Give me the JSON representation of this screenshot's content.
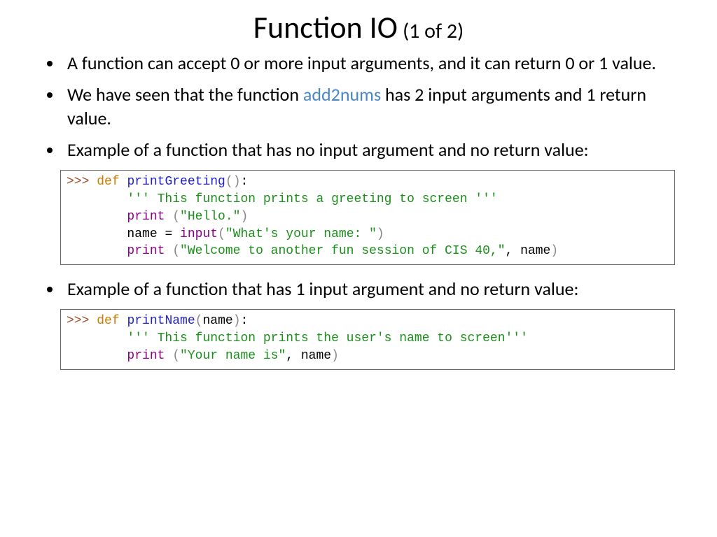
{
  "title": {
    "main": "Function IO",
    "sub": "(1 of 2)"
  },
  "bullets": [
    {
      "text_before": "A function can accept 0 or more input arguments, and it can return 0 or 1 value.",
      "link": "",
      "text_after": ""
    },
    {
      "text_before": "We have seen that the function ",
      "link": "add2nums",
      "text_after": " has 2 input arguments and 1 return value."
    },
    {
      "text_before": "Example of a function that has no input argument and no return value:",
      "link": "",
      "text_after": ""
    }
  ],
  "bullet4": "Example of a function that has 1 input argument and no return value:",
  "code1": {
    "prompt": ">>> ",
    "kw_def": "def",
    "fn": "printGreeting",
    "lp": "(",
    "rp": ")",
    "colon": ":",
    "doc": "''' This function prints a greeting to screen '''",
    "print": "print",
    "sp_open": " (",
    "tp": "(",
    "cp": ")",
    "str_hello": "\"Hello.\"",
    "var_name": "name",
    "assign": " = ",
    "input": "input",
    "str_prompt": "\"What's your name: \"",
    "str_welcome": "\"Welcome to another fun session of CIS 40,\"",
    "comma_name": ", name"
  },
  "code2": {
    "prompt": ">>> ",
    "kw_def": "def",
    "fn": "printName",
    "lp": "(",
    "rp": ")",
    "colon": ":",
    "param": "name",
    "doc": "''' This function prints the user's name to screen'''",
    "print": "print",
    "sp_open": " (",
    "cp": ")",
    "str_out": "\"Your name is\"",
    "comma_name": ", name"
  }
}
